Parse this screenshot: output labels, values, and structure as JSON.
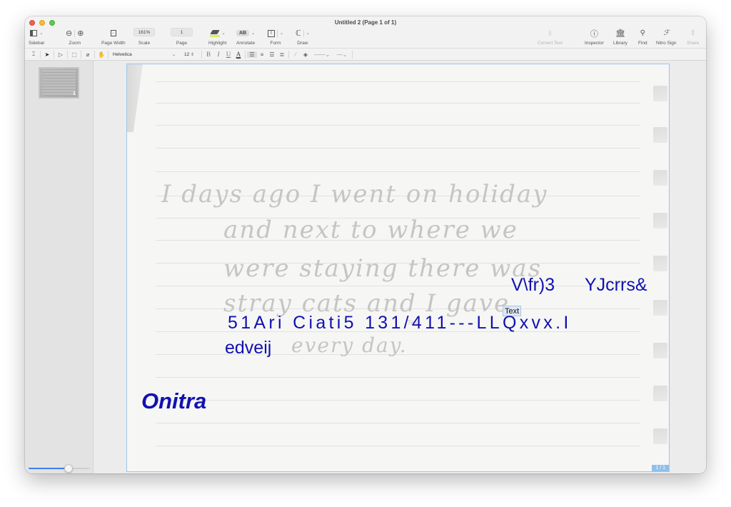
{
  "window": {
    "title": "Untitled 2 (Page 1 of 1)"
  },
  "toolbar": {
    "sidebar_label": "Sidebar",
    "zoom_label": "Zoom",
    "page_width_label": "Page Width",
    "scale_label": "Scale",
    "scale_value": "161%",
    "page_label": "Page",
    "page_value": "1",
    "highlight_label": "Highlight",
    "annotate_label": "Annotate",
    "annotate_icon_text": "AB",
    "form_label": "Form",
    "draw_label": "Draw",
    "correct_text_label": "Correct Text",
    "inspector_label": "Inspector",
    "library_label": "Library",
    "find_label": "Find",
    "nitro_sign_label": "Nitro Sign",
    "share_label": "Share"
  },
  "format_bar": {
    "font_name": "Helvetica",
    "font_size": "12",
    "bold": "B",
    "italic": "I",
    "underline": "U",
    "text_color": "A"
  },
  "sidebar": {
    "thumbnails": [
      {
        "page_number": "1"
      }
    ],
    "zoom_slider_value": 0.67
  },
  "document": {
    "handwriting_lines": [
      "I days ago I went on holiday",
      "and next to where we",
      "were staying there was",
      "stray cats and I gave",
      "every day."
    ],
    "ocr_text": {
      "line1_left": "V\\fr)3",
      "line1_right": "YJcrrs&",
      "line2": "51Ari Ciati5 131/411---LLQxvx.I",
      "line3": "edveij",
      "signature": "Onitra"
    },
    "text_annotation_label": "Text",
    "ghost_label": "Tex",
    "page_indicator": "1 / 1"
  },
  "colors": {
    "ocr_text": "#1111b1",
    "selection_border": "#9cc6ec",
    "slider_fill": "#3b7ff5"
  }
}
